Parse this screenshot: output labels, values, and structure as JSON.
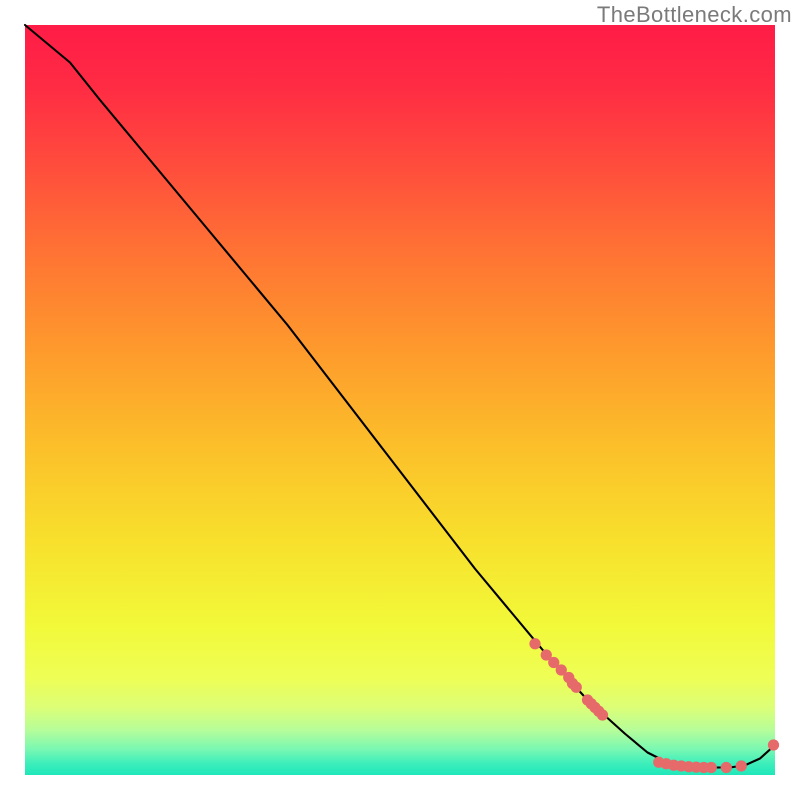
{
  "watermark": "TheBottleneck.com",
  "chart_data": {
    "type": "line",
    "title": "",
    "xlabel": "",
    "ylabel": "",
    "xlim": [
      0,
      100
    ],
    "ylim": [
      0,
      100
    ],
    "grid": false,
    "legend": false,
    "series": [
      {
        "name": "bottleneck-curve",
        "color": "#000000",
        "x": [
          0,
          6,
          10,
          15,
          20,
          25,
          30,
          35,
          40,
          45,
          50,
          55,
          60,
          65,
          70,
          75,
          80,
          83,
          85,
          88,
          90,
          92,
          94,
          96,
          98,
          100
        ],
        "y": [
          100,
          95,
          90,
          84,
          78,
          72,
          66,
          60,
          53.5,
          47,
          40.5,
          34,
          27.5,
          21.5,
          15.5,
          10,
          5.5,
          3,
          2,
          1.2,
          1,
          1,
          1,
          1.3,
          2.2,
          4
        ]
      }
    ],
    "markers": [
      {
        "name": "highlighted-points",
        "shape": "circle",
        "color": "#E66A6A",
        "points": [
          {
            "x": 68.0,
            "y": 17.5
          },
          {
            "x": 69.5,
            "y": 16.0
          },
          {
            "x": 70.5,
            "y": 15.0
          },
          {
            "x": 71.5,
            "y": 14.0
          },
          {
            "x": 72.5,
            "y": 13.0
          },
          {
            "x": 73.0,
            "y": 12.2
          },
          {
            "x": 73.5,
            "y": 11.7
          },
          {
            "x": 75.0,
            "y": 10.0
          },
          {
            "x": 75.5,
            "y": 9.5
          },
          {
            "x": 76.0,
            "y": 9.0
          },
          {
            "x": 76.5,
            "y": 8.5
          },
          {
            "x": 77.0,
            "y": 8.0
          },
          {
            "x": 84.5,
            "y": 1.7
          },
          {
            "x": 85.5,
            "y": 1.5
          },
          {
            "x": 86.5,
            "y": 1.3
          },
          {
            "x": 87.5,
            "y": 1.2
          },
          {
            "x": 88.5,
            "y": 1.1
          },
          {
            "x": 89.5,
            "y": 1.05
          },
          {
            "x": 90.5,
            "y": 1.0
          },
          {
            "x": 91.5,
            "y": 1.0
          },
          {
            "x": 93.5,
            "y": 1.0
          },
          {
            "x": 95.5,
            "y": 1.2
          },
          {
            "x": 99.8,
            "y": 4.0
          }
        ]
      }
    ],
    "background_gradient": {
      "type": "vertical",
      "stops": [
        {
          "offset": 0.0,
          "color": "#FF1C47"
        },
        {
          "offset": 0.08,
          "color": "#FF2B44"
        },
        {
          "offset": 0.18,
          "color": "#FF4A3D"
        },
        {
          "offset": 0.3,
          "color": "#FF7234"
        },
        {
          "offset": 0.42,
          "color": "#FE962D"
        },
        {
          "offset": 0.55,
          "color": "#FCBC2A"
        },
        {
          "offset": 0.68,
          "color": "#F8DE2C"
        },
        {
          "offset": 0.8,
          "color": "#F2F939"
        },
        {
          "offset": 0.87,
          "color": "#EEFE55"
        },
        {
          "offset": 0.91,
          "color": "#DCFE77"
        },
        {
          "offset": 0.94,
          "color": "#B6FD99"
        },
        {
          "offset": 0.965,
          "color": "#7BF8B2"
        },
        {
          "offset": 0.985,
          "color": "#3CEEBB"
        },
        {
          "offset": 1.0,
          "color": "#1FE7BA"
        }
      ]
    }
  }
}
